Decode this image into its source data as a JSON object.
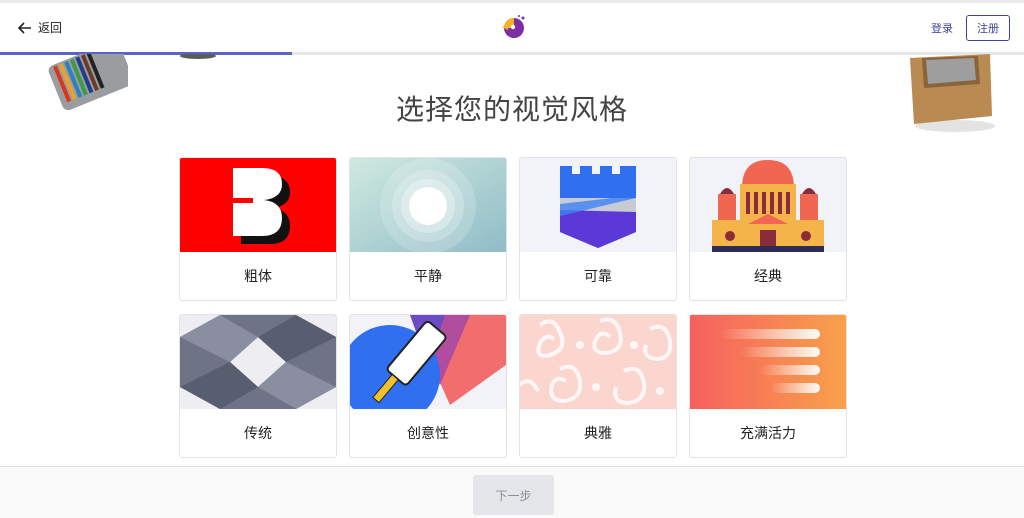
{
  "header": {
    "back_label": "返回",
    "login_label": "登录",
    "signup_label": "注册",
    "progress": 0.285,
    "accent_color": "#3d4596"
  },
  "main": {
    "title": "选择您的视觉风格"
  },
  "styles": [
    {
      "label": "粗体",
      "icon": "bold-b-icon"
    },
    {
      "label": "平静",
      "icon": "calm-circles-icon"
    },
    {
      "label": "可靠",
      "icon": "castle-shield-icon"
    },
    {
      "label": "经典",
      "icon": "classic-palace-icon"
    },
    {
      "label": "传统",
      "icon": "traditional-pattern-icon"
    },
    {
      "label": "创意性",
      "icon": "paint-roller-icon"
    },
    {
      "label": "典雅",
      "icon": "damask-pattern-icon"
    },
    {
      "label": "充满活力",
      "icon": "energetic-stripes-icon"
    }
  ],
  "footer": {
    "next_label": "下一步"
  }
}
